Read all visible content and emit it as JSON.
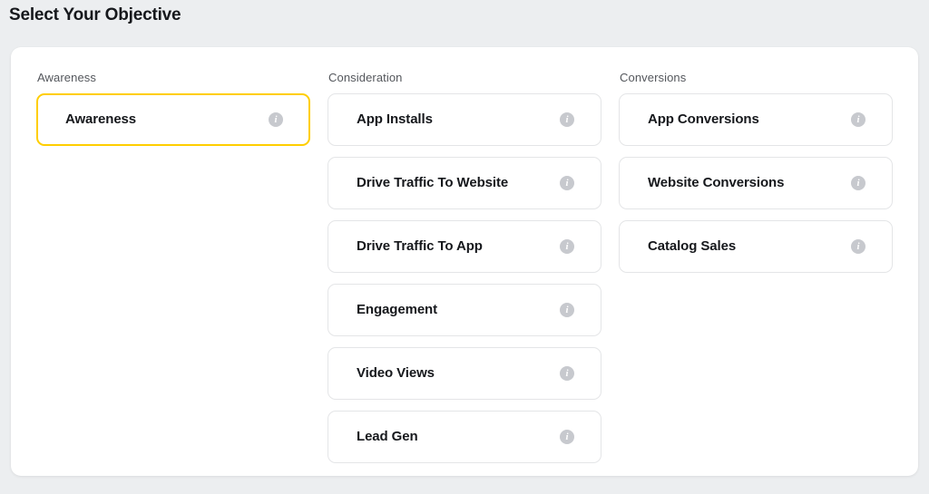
{
  "page": {
    "title": "Select Your Objective"
  },
  "info_icon_name": "info-icon",
  "info_icon_glyph": "i",
  "colors": {
    "selected_border": "#FFCE00",
    "card_border": "#E4E5E7",
    "page_background": "#ECEEF0",
    "panel_background": "#FFFFFF",
    "info_icon_fill": "#C7C9CE",
    "header_text": "#54575C",
    "label_text": "#16181C"
  },
  "columns": [
    {
      "header": "Awareness",
      "options": [
        {
          "label": "Awareness",
          "selected": true,
          "info": "i"
        }
      ]
    },
    {
      "header": "Consideration",
      "options": [
        {
          "label": "App Installs",
          "selected": false,
          "info": "i"
        },
        {
          "label": "Drive Traffic To Website",
          "selected": false,
          "info": "i"
        },
        {
          "label": "Drive Traffic To App",
          "selected": false,
          "info": "i"
        },
        {
          "label": "Engagement",
          "selected": false,
          "info": "i"
        },
        {
          "label": "Video Views",
          "selected": false,
          "info": "i"
        },
        {
          "label": "Lead Gen",
          "selected": false,
          "info": "i"
        }
      ]
    },
    {
      "header": "Conversions",
      "options": [
        {
          "label": "App Conversions",
          "selected": false,
          "info": "i"
        },
        {
          "label": "Website Conversions",
          "selected": false,
          "info": "i"
        },
        {
          "label": "Catalog Sales",
          "selected": false,
          "info": "i"
        }
      ]
    }
  ]
}
